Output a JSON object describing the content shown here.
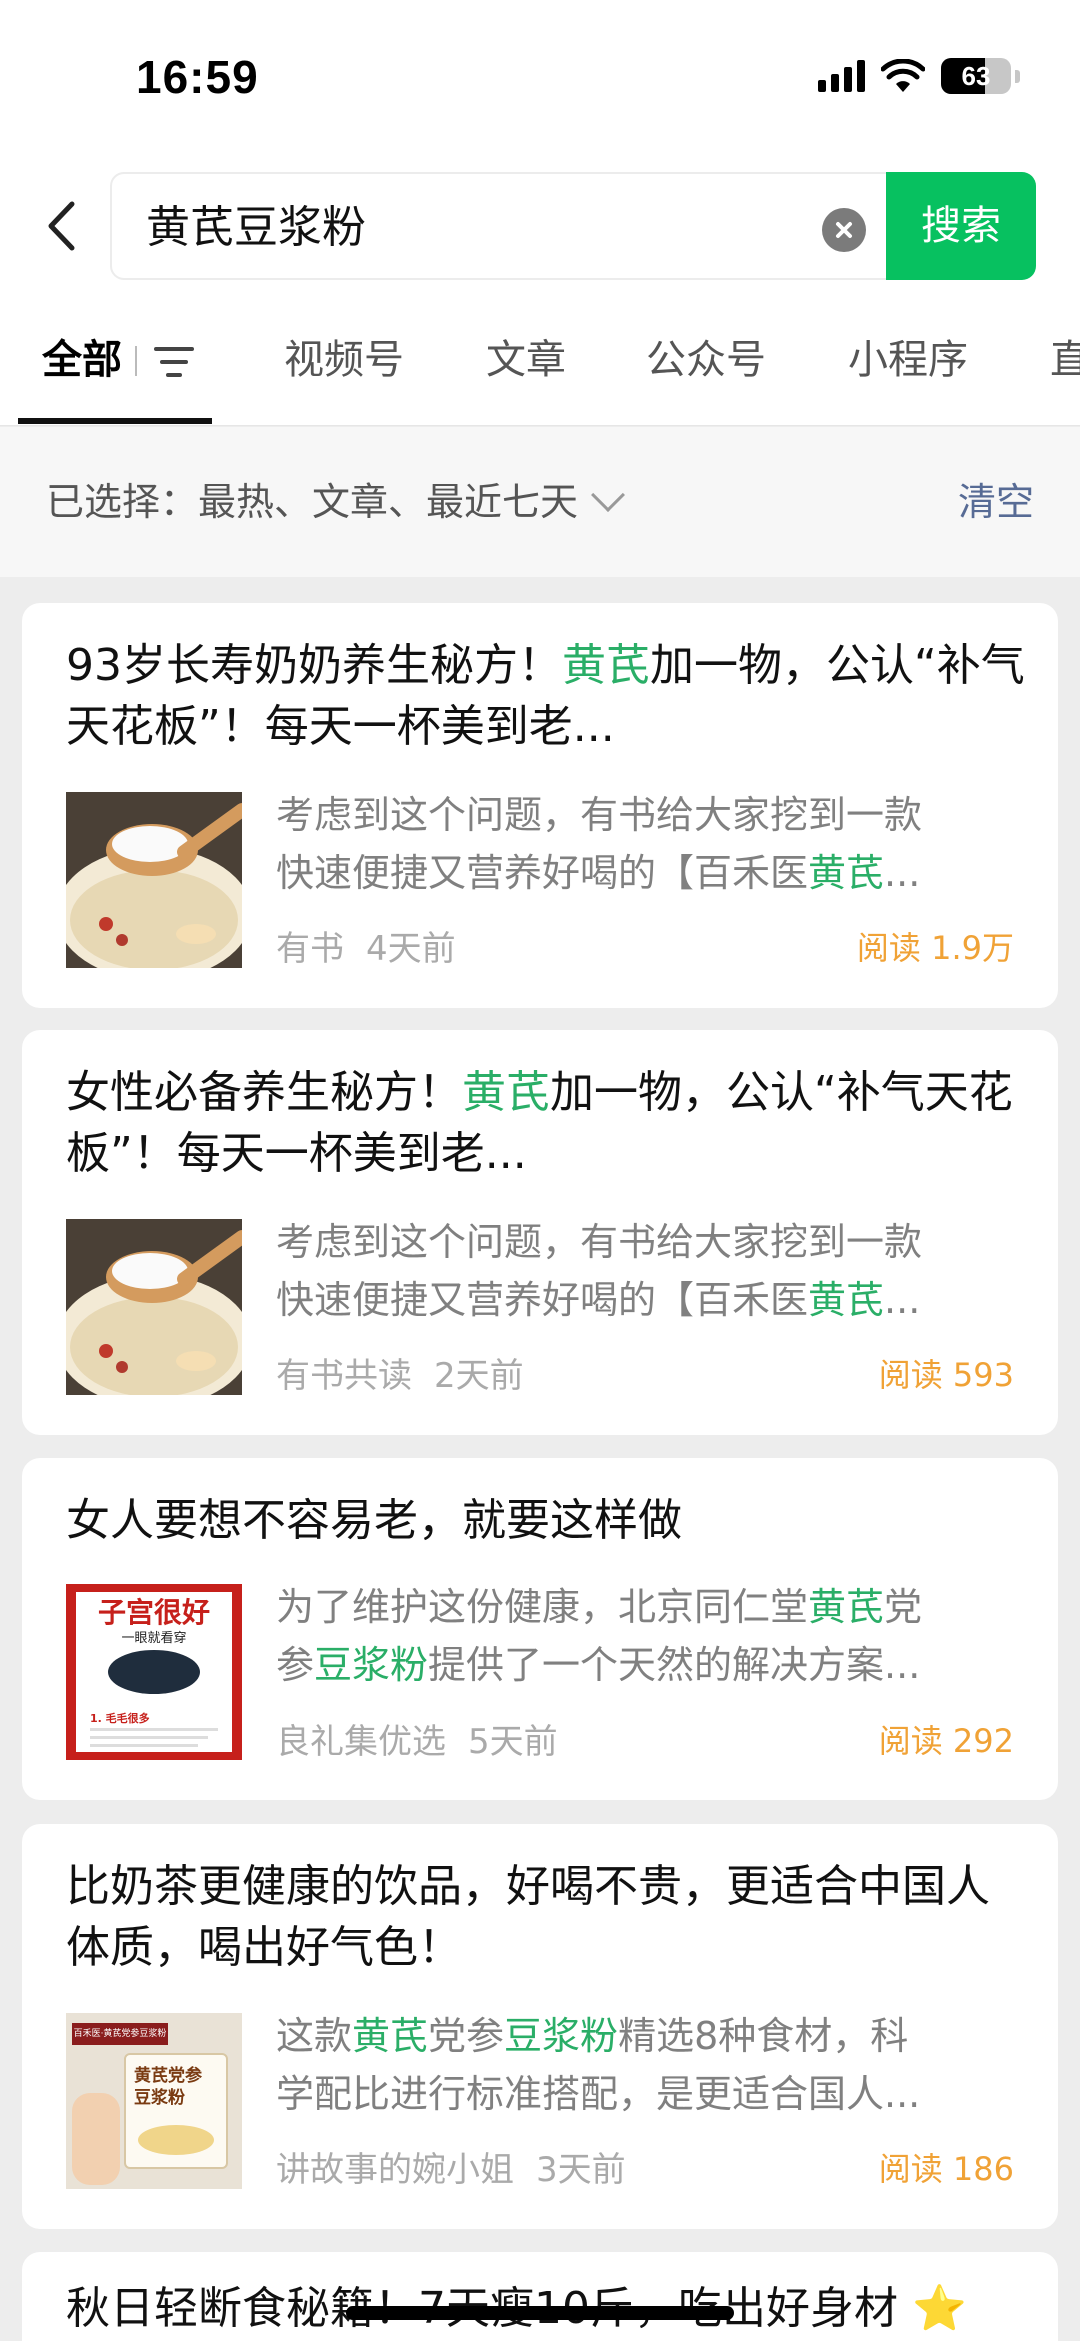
{
  "status_bar": {
    "time": "16:59",
    "battery": "63",
    "battery_level": 0.63
  },
  "search": {
    "query": "黄芪豆浆粉",
    "button": "搜索"
  },
  "tabs": [
    "全部",
    "视频号",
    "文章",
    "公众号",
    "小程序",
    "直"
  ],
  "filter": {
    "label": "已选择：最热、文章、最近七天",
    "clear": "清空"
  },
  "results": [
    {
      "title": [
        {
          "text": "93岁长寿奶奶养生秘方！",
          "hl": false
        },
        {
          "text": "黄芪",
          "hl": true
        },
        {
          "text": "加一物，公认“补气天花板”！每天一杯美到老...",
          "hl": false
        }
      ],
      "snippet": [
        [
          {
            "text": "考虑到这个问题，有书给大家挖到一款",
            "hl": false
          }
        ],
        [
          {
            "text": "快速便捷又营养好喝的【百禾医",
            "hl": false
          },
          {
            "text": "黄芪",
            "hl": true
          },
          {
            "text": "...",
            "hl": false
          }
        ]
      ],
      "source": "有书",
      "time": "4天前",
      "read": "阅读 1.9万",
      "thumb": "soy-milk-spoon-photo"
    },
    {
      "title": [
        {
          "text": "女性必备养生秘方！",
          "hl": false
        },
        {
          "text": "黄芪",
          "hl": true
        },
        {
          "text": "加一物，公认“补气天花板”！每天一杯美到老...",
          "hl": false
        }
      ],
      "snippet": [
        [
          {
            "text": "考虑到这个问题，有书给大家挖到一款",
            "hl": false
          }
        ],
        [
          {
            "text": "快速便捷又营养好喝的【百禾医",
            "hl": false
          },
          {
            "text": "黄芪",
            "hl": true
          },
          {
            "text": "...",
            "hl": false
          }
        ]
      ],
      "source": "有书共读",
      "time": "2天前",
      "read": "阅读 593",
      "thumb": "soy-milk-spoon-photo"
    },
    {
      "title": [
        {
          "text": "女人要想不容易老，就要这样做",
          "hl": false
        }
      ],
      "snippet": [
        [
          {
            "text": "为了维护这份健康，北京同仁堂",
            "hl": false
          },
          {
            "text": "黄芪",
            "hl": true
          },
          {
            "text": "党",
            "hl": false
          }
        ],
        [
          {
            "text": "参",
            "hl": false
          },
          {
            "text": "豆浆粉",
            "hl": true
          },
          {
            "text": "提供了一个天然的解决方案...",
            "hl": false
          }
        ]
      ],
      "source": "良礼集优选",
      "time": "5天前",
      "read": "阅读 292",
      "thumb": "poster-graphic",
      "thumb_text": {
        "headline": "子宫很好",
        "sub": "一眼就看穿",
        "point": "1. 毛毛很多"
      }
    },
    {
      "title": [
        {
          "text": "比奶茶更健康的饮品，好喝不贵，更适合中国人体质，喝出好气色！",
          "hl": false
        }
      ],
      "snippet": [
        [
          {
            "text": "这款",
            "hl": false
          },
          {
            "text": "黄芪",
            "hl": true
          },
          {
            "text": "党参",
            "hl": false
          },
          {
            "text": "豆浆粉",
            "hl": true
          },
          {
            "text": "精选8种食材，科",
            "hl": false
          }
        ],
        [
          {
            "text": "学配比进行标准搭配，是更适合国人...",
            "hl": false
          }
        ]
      ],
      "source": "讲故事的婉小姐",
      "time": "3天前",
      "read": "阅读 186",
      "thumb": "product-box-photo",
      "thumb_text": {
        "box_title": "黄芪党参豆浆粉",
        "brand": "百禾医·黄芪党参豆浆粉"
      }
    },
    {
      "title": [
        {
          "text": "秋日轻断食秘籍！7天瘦10斤，吃出好身材",
          "hl": false
        }
      ]
    }
  ],
  "colors": {
    "accent": "#07c160",
    "highlight": "#2aae67",
    "read": "#f0a236",
    "link": "#576b95"
  }
}
